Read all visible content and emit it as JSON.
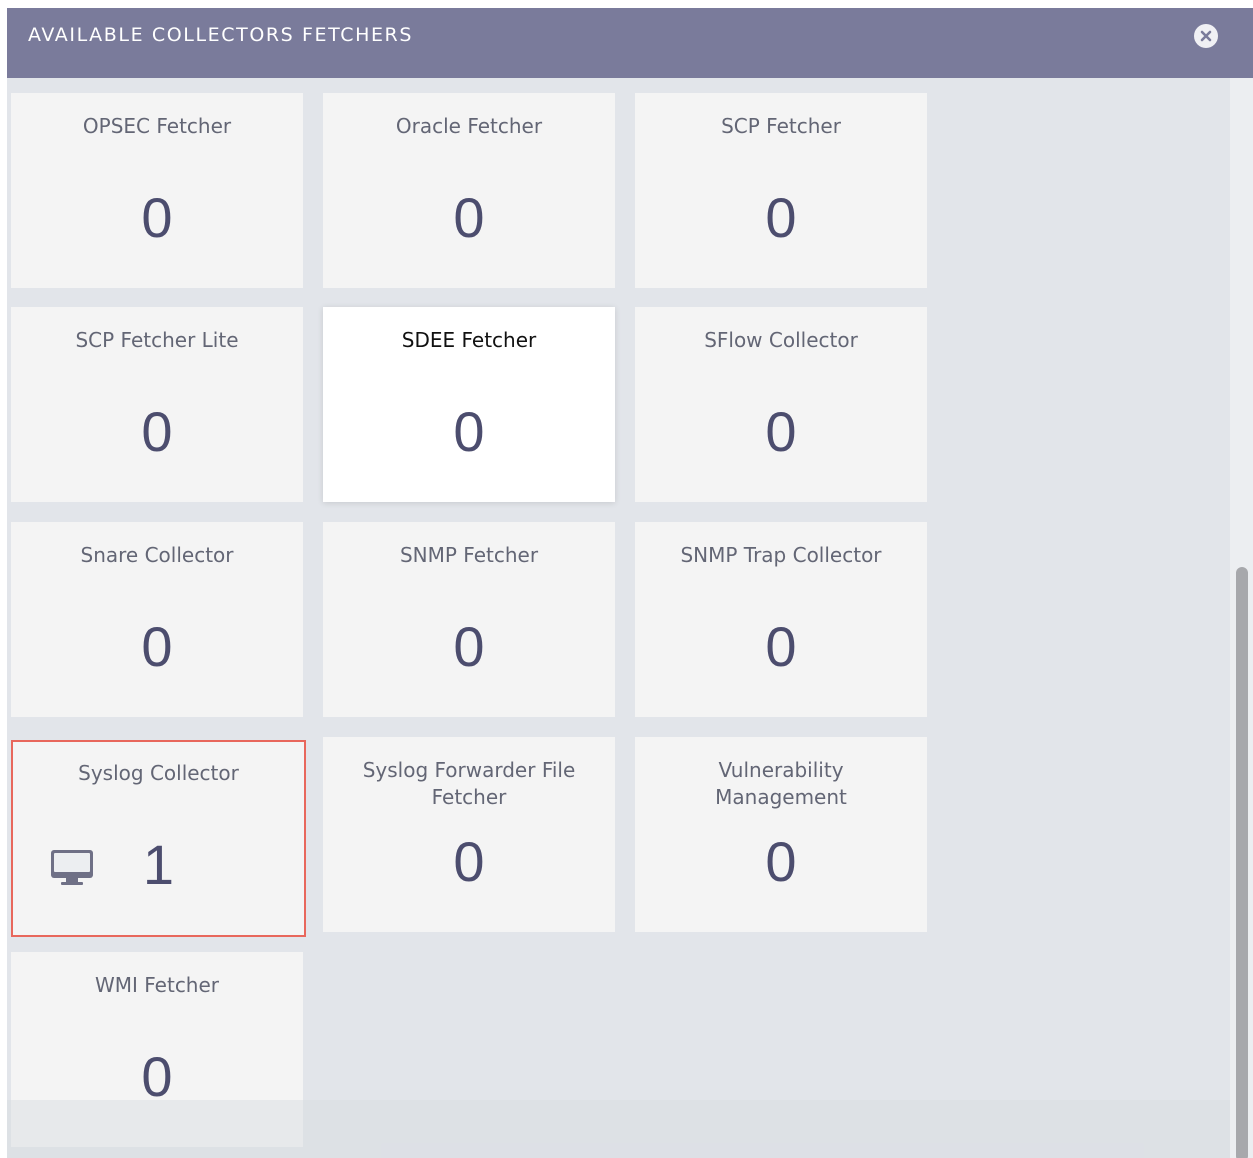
{
  "header": {
    "title": "AVAILABLE COLLECTORS FETCHERS",
    "close_icon": "close-circle-icon"
  },
  "tiles": [
    {
      "label": "OPSEC Fetcher",
      "count": "0"
    },
    {
      "label": "Oracle Fetcher",
      "count": "0"
    },
    {
      "label": "SCP Fetcher",
      "count": "0"
    },
    {
      "label": "SCP Fetcher Lite",
      "count": "0"
    },
    {
      "label": "SDEE Fetcher",
      "count": "0"
    },
    {
      "label": "SFlow Collector",
      "count": "0"
    },
    {
      "label": "Snare Collector",
      "count": "0"
    },
    {
      "label": "SNMP Fetcher",
      "count": "0"
    },
    {
      "label": "SNMP Trap Collector",
      "count": "0"
    },
    {
      "label": "Syslog Collector",
      "count": "1",
      "icon": "monitor-icon"
    },
    {
      "label": "Syslog Forwarder File Fetcher",
      "count": "0"
    },
    {
      "label": "Vulnerability Management",
      "count": "0"
    },
    {
      "label": "WMI Fetcher",
      "count": "0"
    }
  ],
  "colors": {
    "header_bg": "#7a7b9b",
    "panel_bg": "#e2e5ea",
    "tile_bg": "#f4f4f4",
    "selected_border": "#e8675c",
    "count_color": "#4c4d6e"
  }
}
